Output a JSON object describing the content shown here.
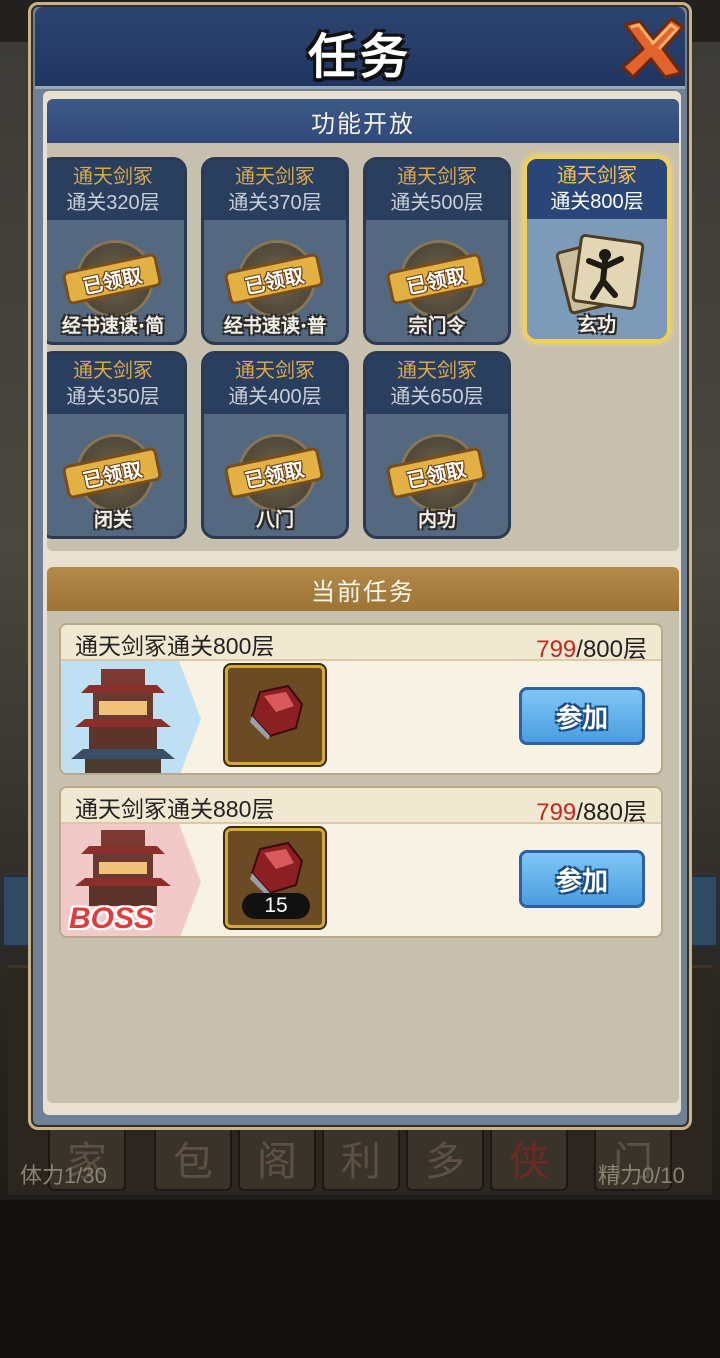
{
  "modal": {
    "title": "任务"
  },
  "unlock_section": {
    "title": "功能开放",
    "cards": [
      {
        "name": "通天剑冢",
        "floor": "通关320层",
        "stamp": "已领取",
        "label": "经书速读·简"
      },
      {
        "name": "通天剑冢",
        "floor": "通关370层",
        "stamp": "已领取",
        "label": "经书速读·普"
      },
      {
        "name": "通天剑冢",
        "floor": "通关500层",
        "stamp": "已领取",
        "label": "宗门令"
      },
      {
        "name": "通天剑冢",
        "floor": "通关800层",
        "stamp": "",
        "label": "玄功"
      },
      {
        "name": "通天剑冢",
        "floor": "通关350层",
        "stamp": "已领取",
        "label": "闭关"
      },
      {
        "name": "通天剑冢",
        "floor": "通关400层",
        "stamp": "已领取",
        "label": "八门"
      },
      {
        "name": "通天剑冢",
        "floor": "通关650层",
        "stamp": "已领取",
        "label": "内功"
      }
    ]
  },
  "task_section": {
    "title": "当前任务",
    "tasks": [
      {
        "title": "通天剑冢通关800层",
        "current": "799",
        "total": "/800层",
        "reward_qty": "",
        "thumb_label": "",
        "button": "参加"
      },
      {
        "title": "通天剑冢通关880层",
        "current": "799",
        "total": "/880层",
        "reward_qty": "15",
        "thumb_label": "BOSS",
        "button": "参加"
      }
    ]
  },
  "background": {
    "bottom_tabs": [
      "家",
      "包",
      "阁",
      "利",
      "多",
      "侠",
      "门"
    ],
    "stamina": "体力1/30",
    "energy": "精力0/10"
  },
  "colors": {
    "accent_gold": "#f1cf5c",
    "progress_red": "#c2281e",
    "join_button_blue": "#4a9de0"
  }
}
